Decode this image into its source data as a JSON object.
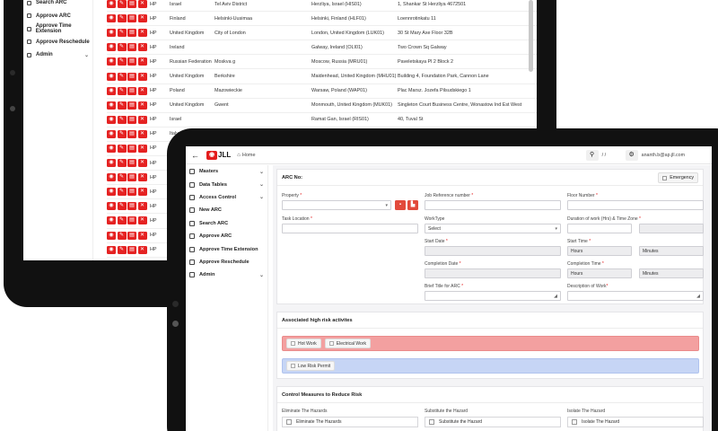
{
  "back": {
    "sidebar": [
      {
        "label": "Search ARC",
        "chev": false
      },
      {
        "label": "Approve ARC",
        "chev": false
      },
      {
        "label": "Approve Time Extension",
        "chev": false
      },
      {
        "label": "Approve Reschedule",
        "chev": false
      },
      {
        "label": "Admin",
        "chev": true
      }
    ],
    "rows": [
      {
        "c1": "HP",
        "c2": "Israel",
        "c3": "Tel Aviv District",
        "c4": "Herzliya, Israel (HIS01)",
        "c5": "1, Shankar St Herzliya 4672501"
      },
      {
        "c1": "HP",
        "c2": "Finland",
        "c3": "Helsinki-Uusimaa",
        "c4": "Helsinki, Finland (HLF01)",
        "c5": "Loennrotinkatu 11"
      },
      {
        "c1": "HP",
        "c2": "United Kingdom",
        "c3": "City of London",
        "c4": "London, United Kingdom (LUK01)",
        "c5": "30 St Mary Axe Floor 32B"
      },
      {
        "c1": "HP",
        "c2": "Ireland",
        "c3": "",
        "c4": "Galway, Ireland (OLI01)",
        "c5": "Two Crown Sq Galway"
      },
      {
        "c1": "HP",
        "c2": "Russian Federation",
        "c3": "Moskva g",
        "c4": "Moscow, Russia (MRU01)",
        "c5": "Paveletskaya Pl 2 Block 2"
      },
      {
        "c1": "HP",
        "c2": "United Kingdom",
        "c3": "Berkshire",
        "c4": "Maidenhead, United Kingdom (MHU01)",
        "c5": "Building 4, Foundation Park, Cannon Lane"
      },
      {
        "c1": "HP",
        "c2": "Poland",
        "c3": "Mazowieckie",
        "c4": "Warsaw, Poland (WAP01)",
        "c5": "Plac Marsz. Jozefa Pilsudskiego 1"
      },
      {
        "c1": "HP",
        "c2": "United Kingdom",
        "c3": "Gwent",
        "c4": "Monmouth, United Kingdom (MUK01)",
        "c5": "Singleton Court Business Centre, Wonastow Ind Est West"
      },
      {
        "c1": "HP",
        "c2": "Israel",
        "c3": "",
        "c4": "Ramat Gan, Israel (RIS01)",
        "c5": "40, Tuval St"
      },
      {
        "c1": "HP",
        "c2": "Italy",
        "c3": "",
        "c4": "",
        "c5": ""
      },
      {
        "c1": "HP",
        "c2": "",
        "c3": "",
        "c4": "",
        "c5": ""
      },
      {
        "c1": "HP",
        "c2": "",
        "c3": "",
        "c4": "",
        "c5": ""
      },
      {
        "c1": "HP",
        "c2": "",
        "c3": "",
        "c4": "",
        "c5": ""
      },
      {
        "c1": "HP",
        "c2": "",
        "c3": "",
        "c4": "",
        "c5": ""
      },
      {
        "c1": "HP",
        "c2": "",
        "c3": "",
        "c4": "",
        "c5": ""
      },
      {
        "c1": "HP",
        "c2": "",
        "c3": "",
        "c4": "",
        "c5": ""
      },
      {
        "c1": "HP",
        "c2": "",
        "c3": "",
        "c4": "",
        "c5": ""
      },
      {
        "c1": "HP",
        "c2": "",
        "c3": "",
        "c4": "",
        "c5": ""
      },
      {
        "c1": "HP",
        "c2": "",
        "c3": "",
        "c4": "",
        "c5": ""
      }
    ]
  },
  "front": {
    "topbar": {
      "logo": "JLL",
      "home": "Home",
      "slashes": "/     /",
      "user": "ananth.b@ap.jll.com"
    },
    "sidebar": [
      {
        "label": "Masters",
        "chev": true
      },
      {
        "label": "Data Tables",
        "chev": true
      },
      {
        "label": "Access Control",
        "chev": true
      },
      {
        "label": "New ARC",
        "chev": false
      },
      {
        "label": "Search ARC",
        "chev": false
      },
      {
        "label": "Approve ARC",
        "chev": false
      },
      {
        "label": "Approve Time Extension",
        "chev": false
      },
      {
        "label": "Approve Reschedule",
        "chev": false
      },
      {
        "label": "Admin",
        "chev": true
      }
    ],
    "form": {
      "heading": "ARC No:",
      "emergency": "Emergency",
      "property": "Property",
      "job_ref": "Job Reference number",
      "floor": "Floor Number",
      "task_location": "Task Location",
      "worktype": "WorkType",
      "worktype_value": "Select",
      "duration": "Duration of work (Hrs) & Time Zone",
      "start_date": "Start Date",
      "start_time": "Start Time",
      "hours": "Hours",
      "minutes": "Minutes",
      "completion_date": "Completion Date",
      "completion_time": "Completion Time",
      "brief_title": "Brief Title for ARC",
      "description": "Description of Work"
    },
    "risk": {
      "heading": "Associated high risk activites",
      "red": [
        "Hot Work",
        "Electrical Work"
      ],
      "blue": [
        "Low Risk Permit"
      ]
    },
    "control": {
      "heading": "Control Measures to Reduce Risk",
      "cols": [
        {
          "label": "Eliminate The Hazards",
          "box": "Eliminate The Hazards"
        },
        {
          "label": "Substitute the Hazard",
          "box": "Substitute the Hazard"
        },
        {
          "label": "Isolate The Hazard",
          "box": "Isolate The Hazard"
        }
      ]
    }
  }
}
